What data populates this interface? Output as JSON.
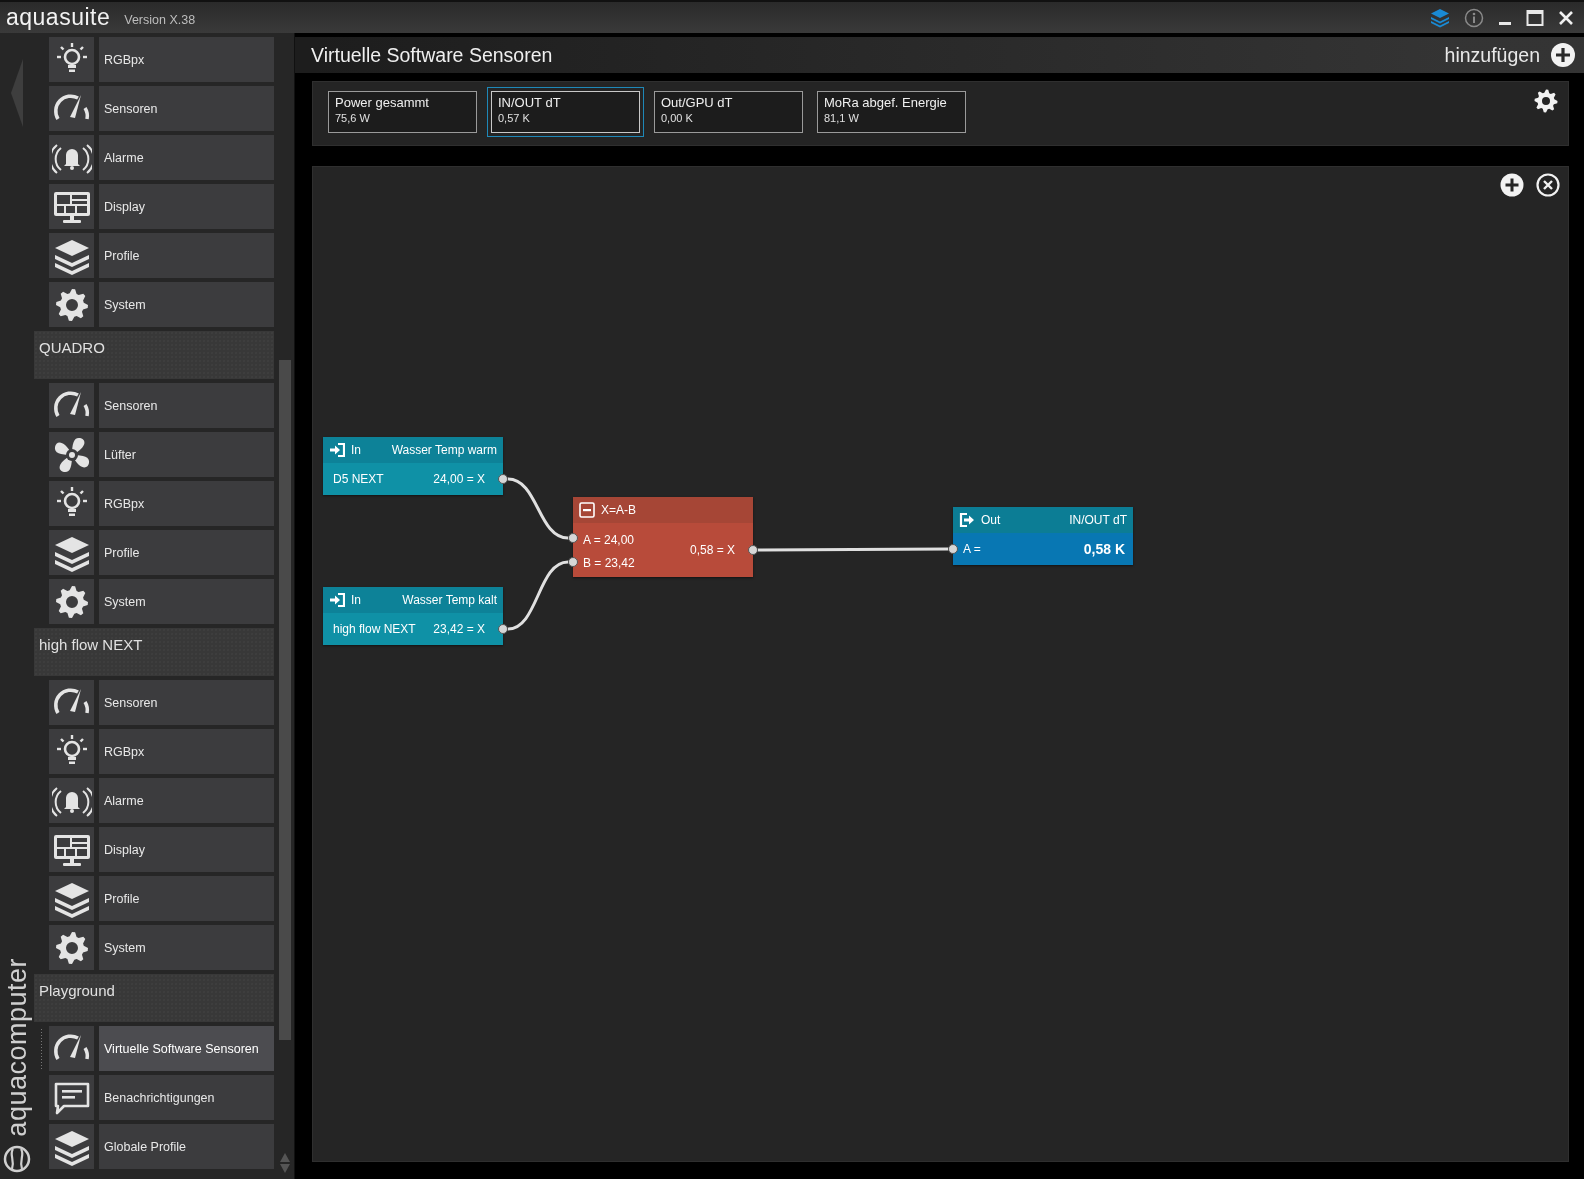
{
  "app": {
    "name": "aquasuite",
    "version": "Version X.38"
  },
  "brand": "aquacomputer",
  "sidebar": {
    "groups": [
      {
        "items": [
          {
            "kind": "lighting",
            "label": "RGBpx",
            "selected": false
          },
          {
            "kind": "sensors",
            "label": "Sensoren",
            "selected": false
          },
          {
            "kind": "alarms",
            "label": "Alarme",
            "selected": false
          },
          {
            "kind": "display",
            "label": "Display",
            "selected": false
          },
          {
            "kind": "profiles",
            "label": "Profile",
            "selected": false
          },
          {
            "kind": "system",
            "label": "System",
            "selected": false
          }
        ]
      },
      {
        "title": "QUADRO",
        "items": [
          {
            "kind": "sensors",
            "label": "Sensoren",
            "selected": false
          },
          {
            "kind": "fans",
            "label": "Lüfter",
            "selected": false
          },
          {
            "kind": "lighting",
            "label": "RGBpx",
            "selected": false
          },
          {
            "kind": "profiles",
            "label": "Profile",
            "selected": false
          },
          {
            "kind": "system",
            "label": "System",
            "selected": false
          }
        ]
      },
      {
        "title": "high flow NEXT",
        "items": [
          {
            "kind": "sensors",
            "label": "Sensoren",
            "selected": false
          },
          {
            "kind": "lighting",
            "label": "RGBpx",
            "selected": false
          },
          {
            "kind": "alarms",
            "label": "Alarme",
            "selected": false
          },
          {
            "kind": "display",
            "label": "Display",
            "selected": false
          },
          {
            "kind": "profiles",
            "label": "Profile",
            "selected": false
          },
          {
            "kind": "system",
            "label": "System",
            "selected": false
          }
        ]
      },
      {
        "title": "Playground",
        "items": [
          {
            "kind": "sensors",
            "label": "Virtuelle Software Sensoren",
            "selected": true
          },
          {
            "kind": "notifications",
            "label": "Benachrichtigungen",
            "selected": false
          },
          {
            "kind": "profiles",
            "label": "Globale Profile",
            "selected": false
          }
        ]
      }
    ]
  },
  "page": {
    "title": "Virtuelle Software Sensoren",
    "add_label": "hinzufügen"
  },
  "sensor_tabs": [
    {
      "name": "Power gesammt",
      "value": "75,6 W",
      "selected": false
    },
    {
      "name": "IN/OUT dT",
      "value": "0,57 K",
      "selected": true
    },
    {
      "name": "Out/GPU dT",
      "value": "0,00 K",
      "selected": false
    },
    {
      "name": "MoRa abgef. Energie",
      "value": "81,1 W",
      "selected": false
    }
  ],
  "nodes": [
    {
      "kind": "input",
      "label": "In",
      "sensor": "Wasser Temp warm",
      "source": "D5 NEXT",
      "value": "24,00 = X"
    },
    {
      "kind": "input",
      "label": "In",
      "sensor": "Wasser Temp kalt",
      "source": "high flow NEXT",
      "value": "23,42 = X"
    },
    {
      "kind": "math",
      "formula": "X=A-B",
      "inputs": [
        "A = 24,00",
        "B = 23,42"
      ],
      "output": "0,58 = X"
    },
    {
      "kind": "output",
      "label": "Out",
      "sensor": "IN/OUT dT",
      "input": "A =",
      "value": "0,58 K"
    }
  ]
}
